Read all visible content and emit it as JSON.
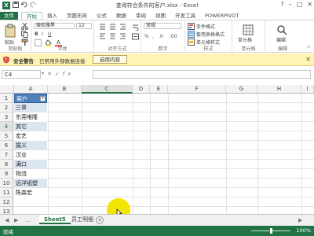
{
  "window": {
    "title": "查询符合条件的客户.xlsx - Excel"
  },
  "tabs": [
    "文件",
    "开始",
    "插入",
    "页面布局",
    "公式",
    "数据",
    "审阅",
    "视图",
    "开发工具",
    "POWERPIVOT"
  ],
  "ribbon": {
    "font_name": "微软雅黑",
    "font_size": "12",
    "number_format": "常规",
    "paste_label": "粘贴",
    "cond_format": "条件格式",
    "table_format": "套用表格格式",
    "cell_style": "单元格样式",
    "cells_label": "单元格",
    "edit_label": "编辑",
    "groups": {
      "clipboard": "剪贴板",
      "font": "字体",
      "alignment": "对齐方式",
      "number": "数字",
      "styles": "样式",
      "cells": "单元格",
      "editing": "编辑"
    }
  },
  "security_bar": {
    "title": "安全警告",
    "message": "已禁用外部数据连接",
    "button": "启用内容"
  },
  "formula_bar": {
    "name_box": "C4",
    "fx": "fx",
    "value": ""
  },
  "grid": {
    "columns": [
      "A",
      "B",
      "C",
      "D",
      "E",
      "F",
      "G",
      "H",
      "I"
    ],
    "rows": [
      "1",
      "2",
      "3",
      "4",
      "5",
      "6",
      "7",
      "8",
      "9",
      "10",
      "11",
      "12",
      "13"
    ],
    "selected_col": "C",
    "selected_row": "4",
    "column_a": [
      "客户",
      "三章",
      "东莞唯隆",
      "其它",
      "宏艺",
      "振义",
      "汉业",
      "满口",
      "物流",
      "远洋纸塑",
      "陈森宏",
      "",
      ""
    ]
  },
  "sheets": {
    "tabs": [
      "Sheet5",
      "员工明细"
    ],
    "active": "Sheet5",
    "add_symbol": "+"
  },
  "status": {
    "text": "就绪",
    "zoom": "100%"
  },
  "colors": {
    "accent": "#217346",
    "table_header": "#4f81bd",
    "table_band": "#dce6f1",
    "security": "#fff4b4",
    "cursor_highlight": "#f2e600"
  }
}
